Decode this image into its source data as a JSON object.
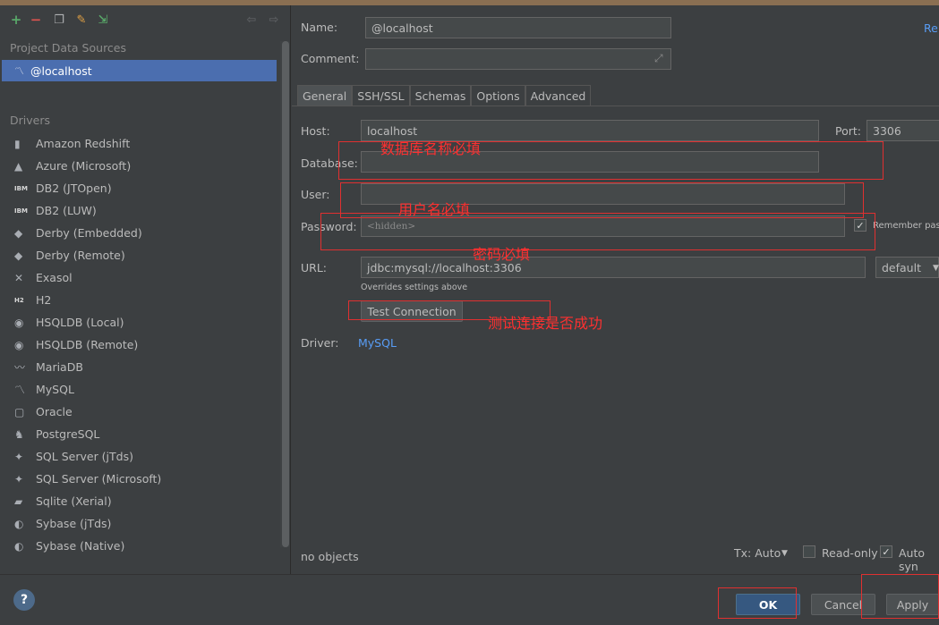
{
  "toolbar": {
    "add_icon": "+",
    "remove_icon": "−",
    "copy_icon": "❐",
    "settings_icon": "✎",
    "import_icon": "⇲",
    "back_icon": "⇦",
    "forward_icon": "⇨"
  },
  "sidebar": {
    "project_title": "Project Data Sources",
    "datasource": "@localhost",
    "drivers_title": "Drivers",
    "drivers": [
      {
        "label": "Amazon Redshift",
        "icon": "▮"
      },
      {
        "label": "Azure (Microsoft)",
        "icon": "▲"
      },
      {
        "label": "DB2 (JTOpen)",
        "icon": "IBM"
      },
      {
        "label": "DB2 (LUW)",
        "icon": "IBM"
      },
      {
        "label": "Derby (Embedded)",
        "icon": "◆"
      },
      {
        "label": "Derby (Remote)",
        "icon": "◆"
      },
      {
        "label": "Exasol",
        "icon": "✕"
      },
      {
        "label": "H2",
        "icon": "H2"
      },
      {
        "label": "HSQLDB (Local)",
        "icon": "◉"
      },
      {
        "label": "HSQLDB (Remote)",
        "icon": "◉"
      },
      {
        "label": "MariaDB",
        "icon": "〰"
      },
      {
        "label": "MySQL",
        "icon": "〽"
      },
      {
        "label": "Oracle",
        "icon": "▢"
      },
      {
        "label": "PostgreSQL",
        "icon": "♞"
      },
      {
        "label": "SQL Server (jTds)",
        "icon": "✦"
      },
      {
        "label": "SQL Server (Microsoft)",
        "icon": "✦"
      },
      {
        "label": "Sqlite (Xerial)",
        "icon": "▰"
      },
      {
        "label": "Sybase (jTds)",
        "icon": "◐"
      },
      {
        "label": "Sybase (Native)",
        "icon": "◐"
      }
    ]
  },
  "form": {
    "name_label": "Name:",
    "name_value": "@localhost",
    "reset_link": "Re",
    "comment_label": "Comment:",
    "comment_value": "",
    "tabs": [
      "General",
      "SSH/SSL",
      "Schemas",
      "Options",
      "Advanced"
    ],
    "host_label": "Host:",
    "host_value": "localhost",
    "port_label": "Port:",
    "port_value": "3306",
    "database_label": "Database:",
    "database_value": "",
    "user_label": "User:",
    "user_value": "",
    "password_label": "Password:",
    "password_value": "<hidden>",
    "remember_label": "Remember passw",
    "url_label": "URL:",
    "url_value": "jdbc:mysql://localhost:3306",
    "url_mode": "default",
    "overrides_note": "Overrides settings above",
    "test_button": "Test Connection",
    "driver_label": "Driver:",
    "driver_value": "MySQL",
    "objects_status": "no objects",
    "tx_label": "Tx: Auto",
    "readonly_label": "Read-only",
    "autosync_label": "Auto syn"
  },
  "annotations": {
    "database_note": "数据库名称必填",
    "user_note": "用户名必填",
    "password_note": "密码必填",
    "test_note": "测试连接是否成功"
  },
  "buttons": {
    "help": "?",
    "ok": "OK",
    "cancel": "Cancel",
    "apply": "Apply"
  },
  "colors": {
    "accent": "#4b6eaf",
    "annotation": "#e03030",
    "link": "#589df6"
  }
}
